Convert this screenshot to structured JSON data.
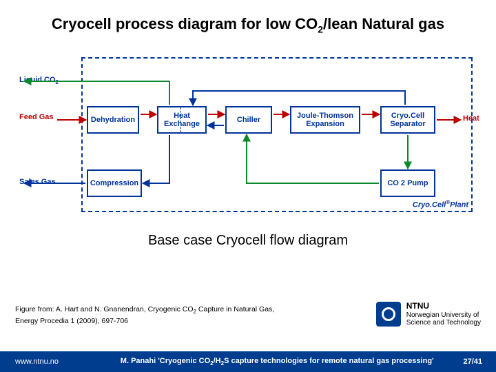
{
  "title_a": "Cryocell process diagram for low CO",
  "title_sub": "2",
  "title_b": "/lean Natural gas",
  "side": {
    "liquid_a": "Liquid CO",
    "liquid_sub": "2",
    "feed": "Feed Gas",
    "sales": "Sales Gas",
    "heat": "Heat"
  },
  "units": {
    "dehyd": "Dehydration",
    "hx": "Heat Exchange",
    "chiller": "Chiller",
    "jt": "Joule-Thomson Expansion",
    "sep": "Cryo.Cell Separator",
    "comp": "Compression",
    "pump": "CO 2 Pump"
  },
  "plant_a": "Cryo.Cell",
  "plant_sup": "®",
  "plant_b": "Plant",
  "caption": "Base case Cryocell flow diagram",
  "citation_line1_a": "Figure from: A. Hart and N. Gnanendran, Cryogenic CO",
  "citation_line1_sub": "2",
  "citation_line1_b": " Capture in Natural Gas,",
  "citation_line2": "Energy Procedia 1 (2009), 697-706",
  "logo": {
    "ntnu": "NTNU",
    "l1": "Norwegian University of",
    "l2": "Science and Technology"
  },
  "footer": {
    "url": "www.ntnu.no",
    "title_a": "M. Panahi  'Cryogenic CO",
    "title_sub1": "2",
    "title_b": "/H",
    "title_sub2": "2",
    "title_c": "S capture technologies for remote natural gas processing'",
    "page": "27/41"
  }
}
